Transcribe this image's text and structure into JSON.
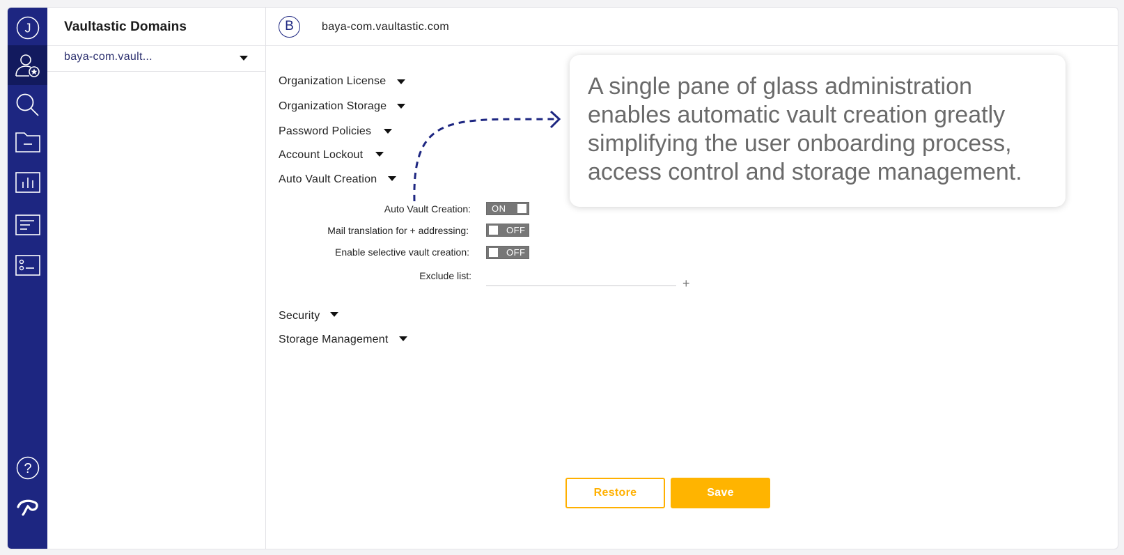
{
  "rail": {
    "user_initial": "J",
    "icons": [
      "user-admin-icon",
      "search-icon",
      "folder-icon",
      "chart-icon",
      "document-icon",
      "id-card-icon"
    ],
    "bottom_icons": [
      "help-icon",
      "brand-logo-icon"
    ],
    "help_glyph": "?"
  },
  "sidebar": {
    "title": "Vaultastic Domains",
    "selected_domain": "baya-com.vault..."
  },
  "header": {
    "badge": "B",
    "domain": "baya-com.vaultastic.com"
  },
  "sections": [
    {
      "label": "Organization License"
    },
    {
      "label": "Organization Storage"
    },
    {
      "label": "Password Policies"
    },
    {
      "label": "Account Lockout"
    },
    {
      "label": "Auto Vault Creation"
    },
    {
      "label": "Security"
    },
    {
      "label": "Storage Management"
    }
  ],
  "auto_vault": {
    "auto_vault_creation": {
      "label": "Auto Vault Creation:",
      "state": "ON"
    },
    "mail_translation": {
      "label": "Mail translation for + addressing:",
      "state": "OFF"
    },
    "selective_creation": {
      "label": "Enable selective vault creation:",
      "state": "OFF"
    },
    "exclude_list": {
      "label": "Exclude list:",
      "value": "",
      "add_glyph": "+"
    }
  },
  "buttons": {
    "restore": "Restore",
    "save": "Save"
  },
  "callout": {
    "text": "A single pane of glass administration enables automatic vault creation greatly simplifying the user onboarding process, access control and storage management."
  },
  "colors": {
    "rail": "#1d2681",
    "rail_active": "#121a5e",
    "accent": "#ffb400",
    "toggle": "#777777"
  }
}
